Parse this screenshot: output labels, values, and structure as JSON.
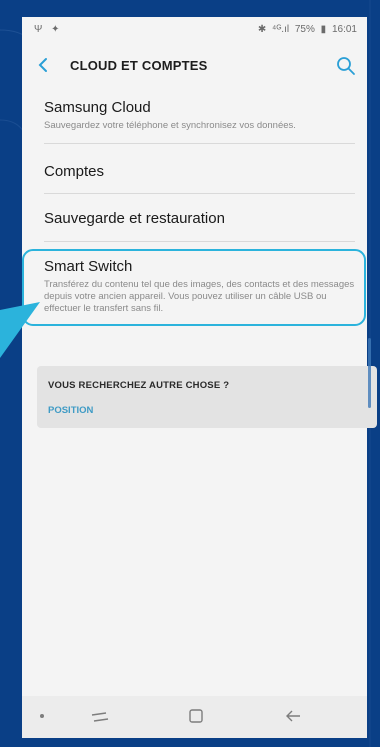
{
  "statusbar": {
    "left_icons": "Ψ ✦",
    "battery": "75%",
    "time": "16:01"
  },
  "header": {
    "title": "CLOUD ET COMPTES"
  },
  "settings": [
    {
      "title": "Samsung Cloud",
      "description": "Sauvegardez votre téléphone et synchronisez vos données."
    },
    {
      "title": "Comptes",
      "description": ""
    },
    {
      "title": "Sauvegarde et restauration",
      "description": ""
    },
    {
      "title": "Smart Switch",
      "description": "Transférez du contenu tel que des images, des contacts et des messages depuis votre ancien appareil. Vous pouvez utiliser un câble USB ou effectuer le transfert sans fil."
    }
  ],
  "suggestion": {
    "title": "VOUS RECHERCHEZ AUTRE CHOSE ?",
    "link": "POSITION"
  },
  "colors": {
    "background": "#0a3f86",
    "highlight": "#2bb3dc",
    "link": "#3f9bc5"
  },
  "icons": [
    "back-arrow-icon",
    "search-icon",
    "bluetooth-icon",
    "signal-icon",
    "battery-icon",
    "recent-apps-icon",
    "home-icon",
    "back-nav-icon"
  ]
}
